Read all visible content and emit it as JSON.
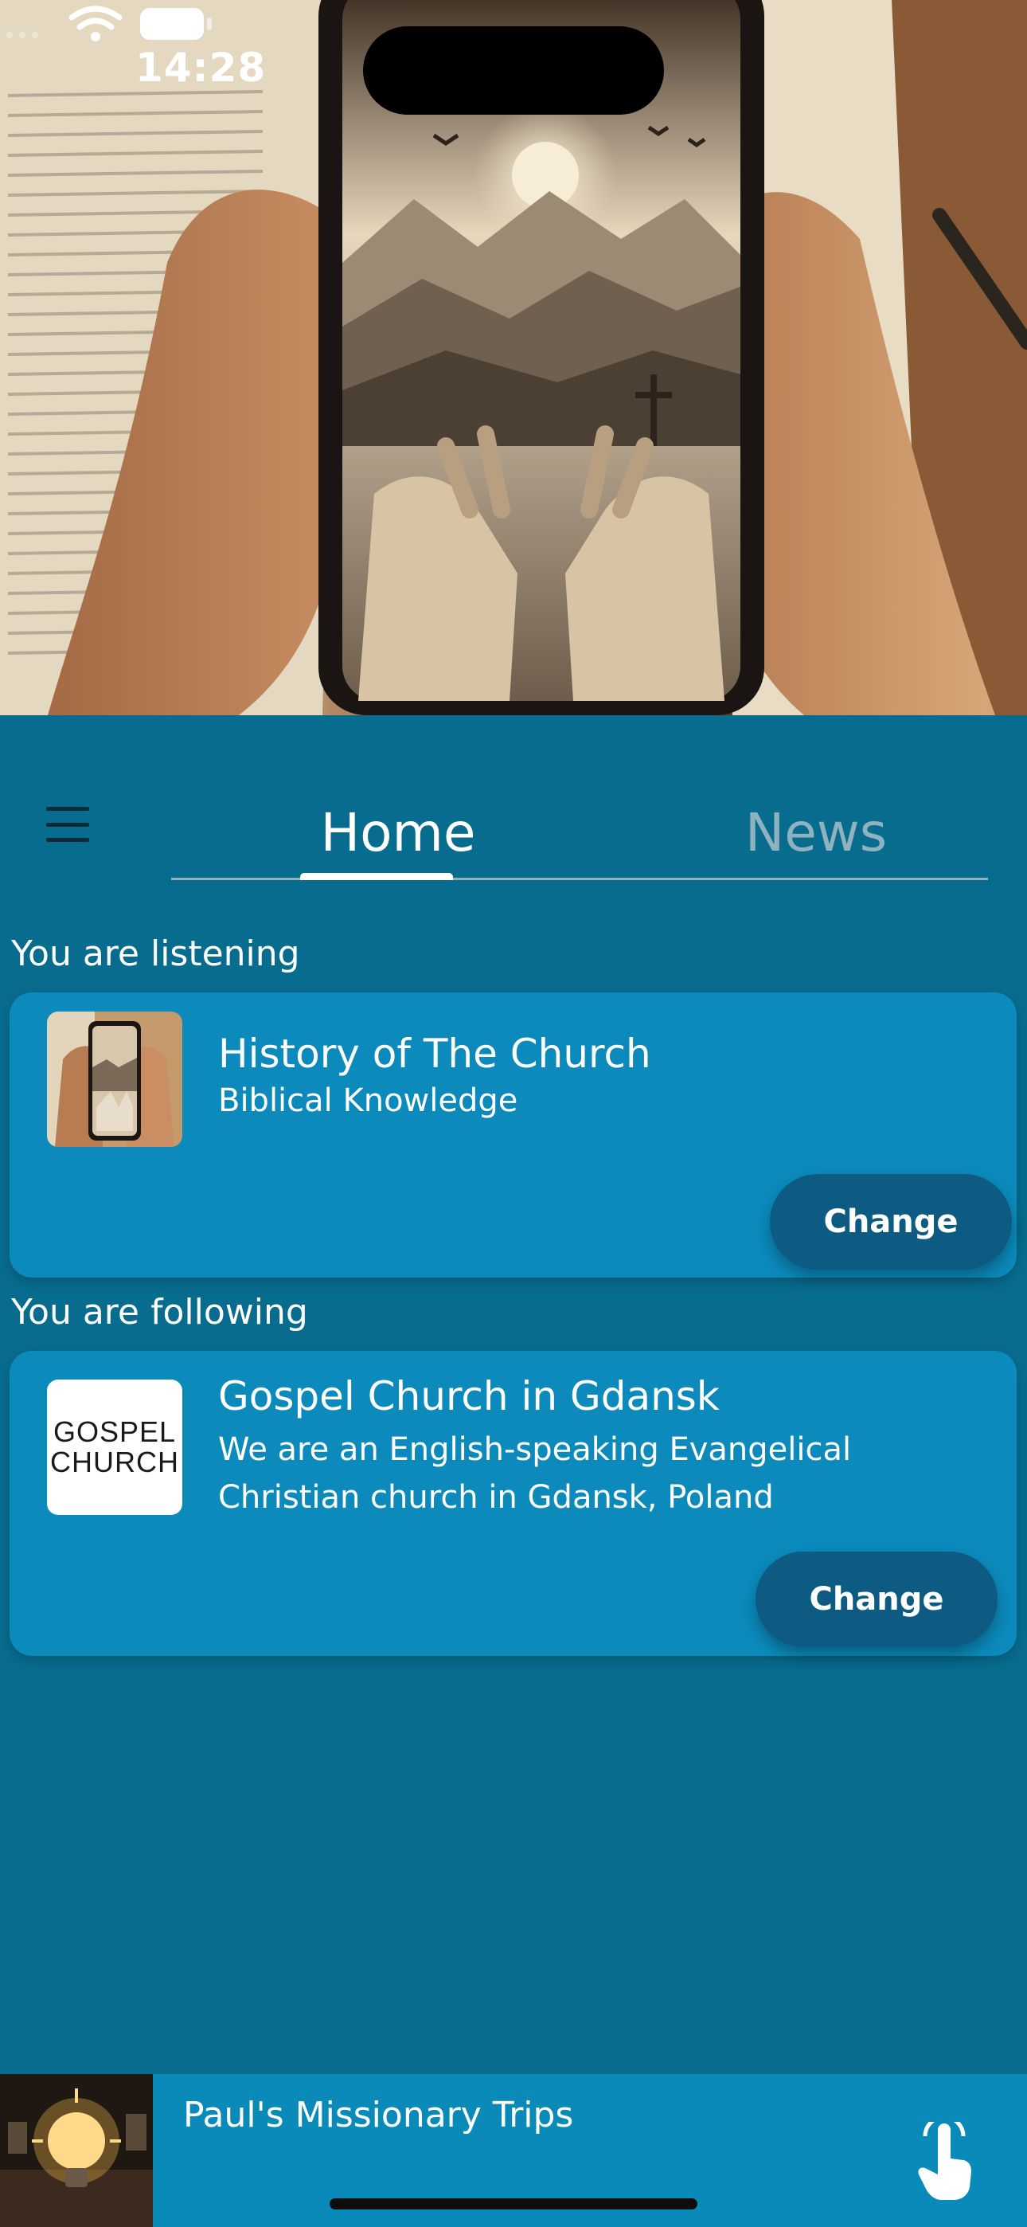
{
  "status_bar": {
    "time": "14:28",
    "icons": [
      "signal-icon",
      "wifi-icon",
      "battery-icon"
    ]
  },
  "navigation": {
    "menu_icon": "hamburger-menu-icon",
    "tabs": [
      {
        "label": "Home",
        "active": true
      },
      {
        "label": "News",
        "active": false
      }
    ]
  },
  "listening": {
    "section_label": "You are listening",
    "title": "History of The Church",
    "subtitle": "Biblical Knowledge",
    "button_label": "Change"
  },
  "following": {
    "section_label": "You are following",
    "logo_text_line1": "GOSPEL",
    "logo_text_line2": "CHURCH",
    "title": "Gospel Church in Gdansk",
    "description": "We are an English-speaking Evangelical Christian church in Gdansk, Poland",
    "button_label": "Change"
  },
  "player": {
    "title": "Paul's Missionary Trips",
    "action_icon": "tap-hand-icon"
  },
  "colors": {
    "background": "#086c8e",
    "card": "#0b8abb",
    "button": "#0d5b82",
    "inactive_tab": "#8fb2bf"
  }
}
